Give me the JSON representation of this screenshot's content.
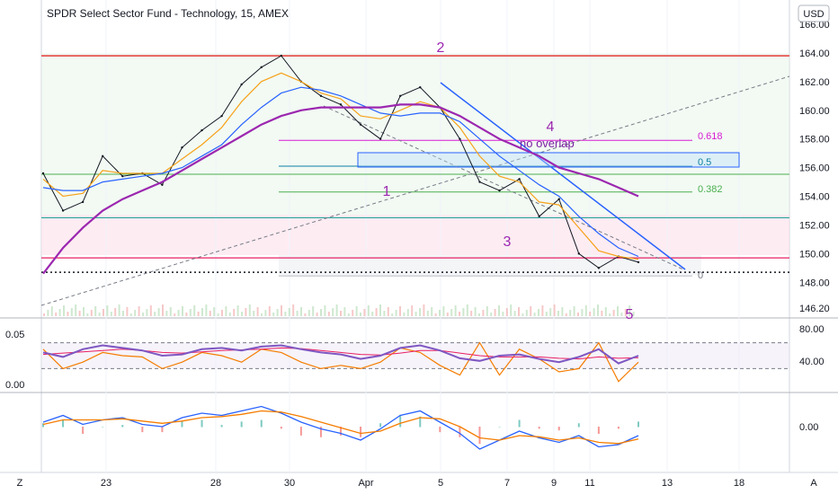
{
  "header": {
    "title": "SPDR Select Sector Fund - Technology, 15, AMEX",
    "currency": "USD"
  },
  "footer": {
    "z_label": "Z",
    "a_label": "A"
  },
  "chart_data": {
    "type": "line",
    "title": "SPDR Select Sector Fund - Technology, 15, AMEX",
    "price_axis": {
      "ticks": [
        "166.00",
        "164.00",
        "162.00",
        "160.00",
        "158.00",
        "156.00",
        "154.00",
        "152.00",
        "150.00",
        "148.00",
        "146.20"
      ],
      "range": [
        146.2,
        166.0
      ]
    },
    "x_ticks": [
      "23",
      "28",
      "30",
      "Apr",
      "5",
      "7",
      "9",
      "11",
      "13",
      "18"
    ],
    "series": [
      {
        "values": [
          155.6,
          153.0,
          153.6,
          156.8,
          155.4,
          155.6,
          154.8,
          157.4,
          158.6,
          159.6,
          161.8,
          163.0,
          163.8,
          162.0,
          161.0,
          160.4,
          159.0,
          158.0,
          161.0,
          161.6,
          160.2,
          158.0,
          155.0,
          154.4,
          155.2,
          152.6,
          153.8,
          150.0,
          149.0,
          149.8,
          149.4
        ]
      },
      {
        "values": [
          155.2,
          154.0,
          154.2,
          155.8,
          155.6,
          155.6,
          155.6,
          156.6,
          157.6,
          158.8,
          160.6,
          162.0,
          162.6,
          162.0,
          161.2,
          160.8,
          159.6,
          159.4,
          160.0,
          160.6,
          160.2,
          158.8,
          156.8,
          155.4,
          155.0,
          153.6,
          153.4,
          151.8,
          150.2,
          149.8,
          149.6
        ]
      },
      {
        "values": [
          154.6,
          154.4,
          154.4,
          155.0,
          155.2,
          155.4,
          155.6,
          156.0,
          156.8,
          157.6,
          159.0,
          160.2,
          161.2,
          161.6,
          161.4,
          161.0,
          160.4,
          159.8,
          159.6,
          159.8,
          159.8,
          159.2,
          158.0,
          156.8,
          155.8,
          154.8,
          154.0,
          152.6,
          151.4,
          150.4,
          149.8
        ]
      },
      {
        "values": [
          148.6,
          150.4,
          151.8,
          153.0,
          153.8,
          154.4,
          155.0,
          155.8,
          156.6,
          157.4,
          158.2,
          159.0,
          159.6,
          160.0,
          160.2,
          160.2,
          160.2,
          160.2,
          160.4,
          160.4,
          160.2,
          159.6,
          158.8,
          158.0,
          157.4,
          156.8,
          156.0,
          155.6,
          155.2,
          154.6,
          154.0
        ]
      }
    ],
    "annotations": {
      "waves": [
        "1",
        "2",
        "3",
        "4",
        "5"
      ],
      "note": "no overlap",
      "levels": [
        {
          "label": "0.618",
          "value": 157.9,
          "color": "#d81bd4"
        },
        {
          "label": "0.5",
          "value": 156.1,
          "color": "#0c7fa3"
        },
        {
          "label": "0.382",
          "value": 154.3,
          "color": "#4caf50"
        },
        {
          "label": "0",
          "value": 148.7,
          "color": "#787b86"
        }
      ],
      "lines": [
        {
          "value": 163.8,
          "color": "#e53935"
        },
        {
          "value": 152.5,
          "color": "#26a69a"
        },
        {
          "value": 149.7,
          "color": "#e91e63"
        },
        {
          "value": 148.7,
          "color": "#131722"
        }
      ]
    },
    "rsi": {
      "left_ticks": [
        "0.05",
        "0.00"
      ],
      "right_ticks": [
        "80.00",
        "40.00"
      ],
      "values": [
        55,
        48,
        60,
        66,
        62,
        58,
        50,
        52,
        60,
        62,
        58,
        64,
        66,
        60,
        55,
        52,
        45,
        50,
        62,
        66,
        58,
        46,
        42,
        50,
        52,
        45,
        40,
        48,
        60,
        38,
        50
      ],
      "signal": [
        52,
        54,
        56,
        58,
        60,
        58,
        55,
        54,
        56,
        58,
        59,
        60,
        62,
        61,
        58,
        55,
        52,
        51,
        54,
        58,
        58,
        54,
        50,
        48,
        48,
        48,
        46,
        45,
        48,
        46,
        47
      ],
      "stoch": [
        60,
        30,
        40,
        55,
        50,
        48,
        30,
        40,
        55,
        50,
        40,
        60,
        55,
        40,
        30,
        35,
        30,
        40,
        62,
        55,
        35,
        20,
        70,
        20,
        60,
        45,
        25,
        30,
        70,
        10,
        40
      ]
    },
    "macd": {
      "right_ticks": [
        "0.00"
      ],
      "macd": [
        0.2,
        0.5,
        0.1,
        0.3,
        0.4,
        0.1,
        0.0,
        0.4,
        0.6,
        0.5,
        0.7,
        0.9,
        0.6,
        0.2,
        -0.1,
        -0.3,
        -0.6,
        -0.1,
        0.5,
        0.7,
        0.2,
        -0.3,
        -1.0,
        -0.6,
        -0.2,
        -0.5,
        -0.7,
        -0.4,
        -0.9,
        -0.8,
        -0.4
      ],
      "signal": [
        0.1,
        0.3,
        0.3,
        0.3,
        0.35,
        0.25,
        0.15,
        0.25,
        0.4,
        0.45,
        0.55,
        0.7,
        0.65,
        0.45,
        0.2,
        -0.05,
        -0.3,
        -0.2,
        0.15,
        0.4,
        0.35,
        0.0,
        -0.5,
        -0.6,
        -0.4,
        -0.45,
        -0.6,
        -0.5,
        -0.7,
        -0.75,
        -0.55
      ]
    }
  }
}
